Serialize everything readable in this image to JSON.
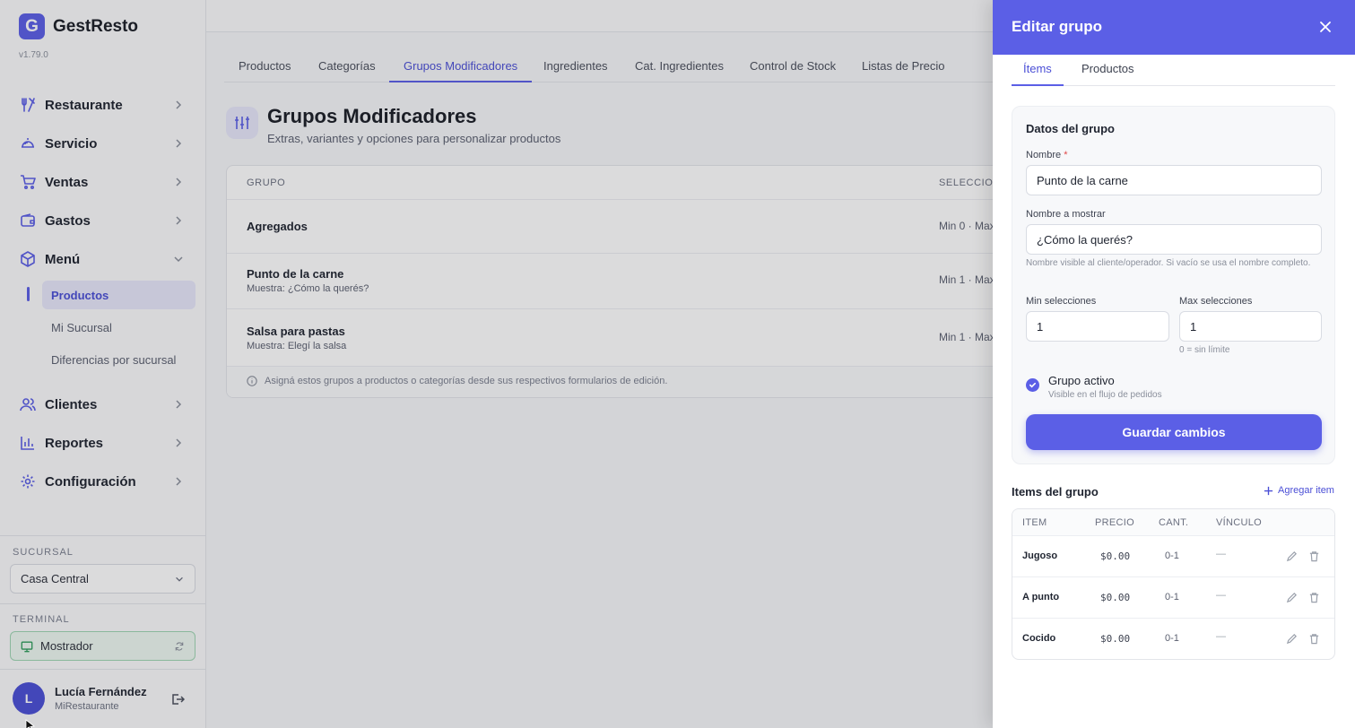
{
  "brand": {
    "logo_letter": "G",
    "name": "GestResto",
    "version": "v1.79.0"
  },
  "sidebar": {
    "nav": [
      {
        "label": "Restaurante",
        "icon": "utensils-icon"
      },
      {
        "label": "Servicio",
        "icon": "cloche-icon"
      },
      {
        "label": "Ventas",
        "icon": "cart-icon"
      },
      {
        "label": "Gastos",
        "icon": "wallet-icon"
      },
      {
        "label": "Menú",
        "icon": "box-icon"
      },
      {
        "label": "Clientes",
        "icon": "users-icon"
      },
      {
        "label": "Reportes",
        "icon": "bar-chart-icon"
      },
      {
        "label": "Configuración",
        "icon": "gear-icon"
      }
    ],
    "menu_subitems": [
      "Productos",
      "Mi Sucursal",
      "Diferencias por sucursal"
    ],
    "sucursal_title": "SUCURSAL",
    "sucursal_value": "Casa Central",
    "terminal_title": "TERMINAL",
    "terminal_value": "Mostrador",
    "user": {
      "initial": "L",
      "name": "Lucía Fernández",
      "org": "MiRestaurante"
    }
  },
  "main": {
    "tabs": [
      "Productos",
      "Categorías",
      "Grupos Modificadores",
      "Ingredientes",
      "Cat. Ingredientes",
      "Control de Stock",
      "Listas de Precio"
    ],
    "active_tab": "Grupos Modificadores",
    "title": "Grupos Modificadores",
    "subtitle": "Extras, variantes y opciones para personalizar productos",
    "table": {
      "headers": {
        "group": "GRUPO",
        "selection": "SELECCION"
      },
      "rows": [
        {
          "title": "Agregados",
          "sub": "",
          "selection": "Min 0 · Max"
        },
        {
          "title": "Punto de la carne",
          "sub": "Muestra: ¿Cómo la querés?",
          "selection": "Min 1 · Max"
        },
        {
          "title": "Salsa para pastas",
          "sub": "Muestra: Elegí la salsa",
          "selection": "Min 1 · Max"
        }
      ],
      "footnote": "Asigná estos grupos a productos o categorías desde sus respectivos formularios de edición."
    }
  },
  "panel": {
    "title": "Editar grupo",
    "tabs": [
      "Ítems",
      "Productos"
    ],
    "active_tab": "Ítems",
    "card_title": "Datos del grupo",
    "name_label": "Nombre",
    "name_required": "*",
    "name_value": "Punto de la carne",
    "display_label": "Nombre a mostrar",
    "display_value": "¿Cómo la querés?",
    "display_hint": "Nombre visible al cliente/operador. Si vacío se usa el nombre completo.",
    "min_label": "Min selecciones",
    "min_value": "1",
    "max_label": "Max selecciones",
    "max_value": "1",
    "max_hint": "0 = sin límite",
    "active_label": "Grupo activo",
    "active_sub": "Visible en el flujo de pedidos",
    "active_checked": true,
    "save_label": "Guardar cambios",
    "items_title": "Items del grupo",
    "add_item_label": "Agregar item",
    "items_headers": [
      "ITEM",
      "PRECIO",
      "CANT.",
      "VÍNCULO"
    ],
    "items": [
      {
        "name": "Jugoso",
        "price": "$0.00",
        "qty": "0-1",
        "link": "—"
      },
      {
        "name": "A punto",
        "price": "$0.00",
        "qty": "0-1",
        "link": "—"
      },
      {
        "name": "Cocido",
        "price": "$0.00",
        "qty": "0-1",
        "link": "—"
      }
    ]
  },
  "colors": {
    "accent": "#5b5fe6",
    "accent_light": "#e7e8fb",
    "terminal_bg": "#eef8f1"
  }
}
